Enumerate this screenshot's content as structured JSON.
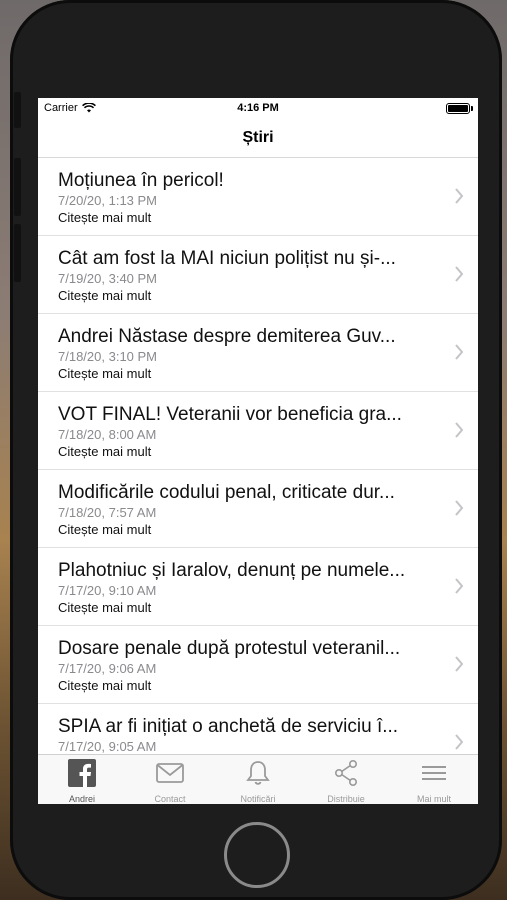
{
  "status": {
    "carrier": "Carrier",
    "time": "4:16 PM"
  },
  "nav": {
    "title": "Știri"
  },
  "list": {
    "more_label": "Citește mai mult",
    "items": [
      {
        "title": "Moțiunea în pericol!",
        "date": "7/20/20, 1:13 PM"
      },
      {
        "title": "Cât am fost la MAI niciun polițist nu și-...",
        "date": "7/19/20, 3:40 PM"
      },
      {
        "title": "Andrei Năstase despre demiterea Guv...",
        "date": "7/18/20, 3:10 PM"
      },
      {
        "title": "VOT FINAL! Veteranii vor beneficia gra...",
        "date": "7/18/20, 8:00 AM"
      },
      {
        "title": "Modificările codului penal, criticate dur...",
        "date": "7/18/20, 7:57 AM"
      },
      {
        "title": "Plahotniuc și Iaralov, denunț pe numele...",
        "date": "7/17/20, 9:10 AM"
      },
      {
        "title": "Dosare penale după protestul veteranil...",
        "date": "7/17/20, 9:06 AM"
      },
      {
        "title": "SPIA ar fi inițiat o anchetă de serviciu î...",
        "date": "7/17/20, 9:05 AM"
      }
    ]
  },
  "tabs": [
    {
      "label": "Andrei",
      "icon": "facebook-icon",
      "active": true
    },
    {
      "label": "Contact",
      "icon": "mail-icon",
      "active": false
    },
    {
      "label": "Notificări",
      "icon": "bell-icon",
      "active": false
    },
    {
      "label": "Distribuie",
      "icon": "share-icon",
      "active": false
    },
    {
      "label": "Mai mult",
      "icon": "menu-icon",
      "active": false
    }
  ]
}
